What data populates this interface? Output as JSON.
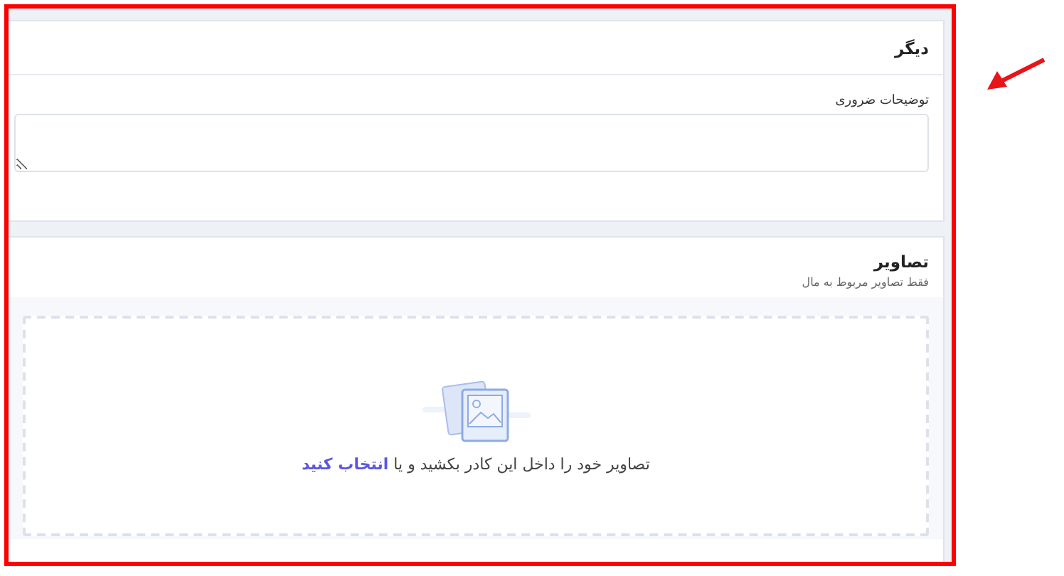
{
  "other_section": {
    "title": "دیگر",
    "field": {
      "label": "توضیحات ضروری"
    }
  },
  "images_section": {
    "title": "تصاویر",
    "subtitle": "فقط تصاویر مربوط به مال",
    "dropzone": {
      "text": "تصاویر خود را داخل این کادر بکشید و یا",
      "link": "انتخاب کنید"
    }
  }
}
